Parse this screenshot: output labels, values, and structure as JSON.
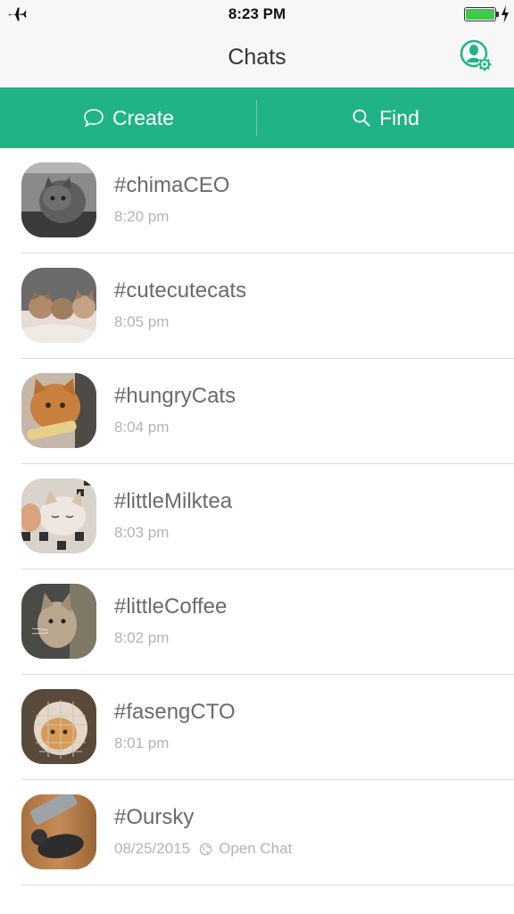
{
  "status_bar": {
    "time": "8:23 PM",
    "airplane_icon": "airplane-icon",
    "battery_icon": "battery-full-icon",
    "charging_icon": "bolt-icon"
  },
  "nav": {
    "title": "Chats",
    "settings_icon": "user-settings-icon"
  },
  "actions": {
    "create_label": "Create",
    "create_icon": "chat-bubble-icon",
    "find_label": "Find",
    "find_icon": "search-icon",
    "accent_color": "#20b386"
  },
  "chats": [
    {
      "name": "#chimaCEO",
      "time": "8:20 pm"
    },
    {
      "name": "#cutecutecats",
      "time": "8:05 pm"
    },
    {
      "name": "#hungryCats",
      "time": "8:04 pm"
    },
    {
      "name": "#littleMilktea",
      "time": "8:03 pm"
    },
    {
      "name": "#littleCoffee",
      "time": "8:02 pm"
    },
    {
      "name": "#fasengCTO",
      "time": "8:01 pm"
    },
    {
      "name": "#Oursky",
      "date": "08/25/2015",
      "status": "Open Chat",
      "status_icon": "globe-icon"
    }
  ]
}
